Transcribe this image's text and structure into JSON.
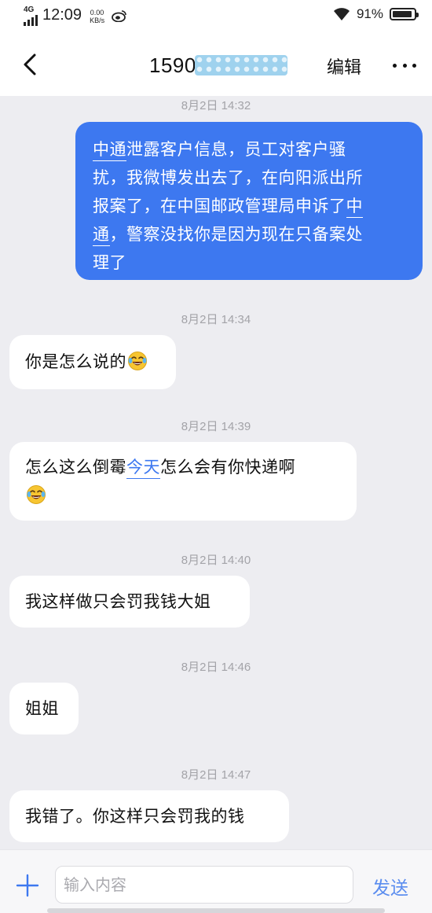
{
  "status_bar": {
    "network": "4G",
    "time": "12:09",
    "speed_value": "0.00",
    "speed_unit": "KB/s",
    "battery_percent": "91%",
    "battery_level": 0.91
  },
  "header": {
    "title_visible": "1590",
    "edit_label": "编辑"
  },
  "messages": [
    {
      "timestamp": "8月2日 14:32",
      "direction": "outgoing",
      "lines": [
        [
          {
            "t": "中通",
            "link": true
          },
          {
            "t": "泄露客户信息，员工对客户骚"
          }
        ],
        [
          {
            "t": "扰，我微博发出去了，在向阳派出所"
          }
        ],
        [
          {
            "t": "报案了，在中国邮政管理局申诉了"
          },
          {
            "t": "中",
            "link": true
          }
        ],
        [
          {
            "t": "通",
            "link": true
          },
          {
            "t": "，警察没找你是因为现在只备案处"
          }
        ],
        [
          {
            "t": "理了"
          }
        ]
      ]
    },
    {
      "timestamp": "8月2日 14:34",
      "direction": "incoming",
      "lines": [
        [
          {
            "t": "你是怎么说的"
          },
          {
            "emoji": "tears-of-joy"
          }
        ]
      ]
    },
    {
      "timestamp": "8月2日 14:39",
      "direction": "incoming",
      "lines": [
        [
          {
            "t": "怎么这么倒霉"
          },
          {
            "t": "今天",
            "link": true
          },
          {
            "t": "怎么会有你快递啊"
          }
        ],
        [
          {
            "emoji": "tears-of-joy"
          }
        ]
      ]
    },
    {
      "timestamp": "8月2日 14:40",
      "direction": "incoming",
      "lines": [
        [
          {
            "t": "我这样做只会罚我钱大姐"
          }
        ]
      ]
    },
    {
      "timestamp": "8月2日 14:46",
      "direction": "incoming",
      "lines": [
        [
          {
            "t": "姐姐"
          }
        ]
      ]
    },
    {
      "timestamp": "8月2日 14:47",
      "direction": "incoming",
      "lines": [
        [
          {
            "t": "我错了。你这样只会罚我的钱"
          }
        ]
      ]
    }
  ],
  "input_bar": {
    "placeholder": "输入内容",
    "send_label": "发送"
  },
  "icons": {
    "back": "chevron-left-icon",
    "more": "more-dots-icon",
    "add": "plus-icon",
    "emoji": "tears-of-joy-emoji"
  },
  "colors": {
    "outgoing_bubble": "#3d78f0",
    "incoming_bubble": "#ffffff",
    "background": "#ededf1",
    "redaction": "#9fd2ee",
    "send": "#5b8def"
  }
}
